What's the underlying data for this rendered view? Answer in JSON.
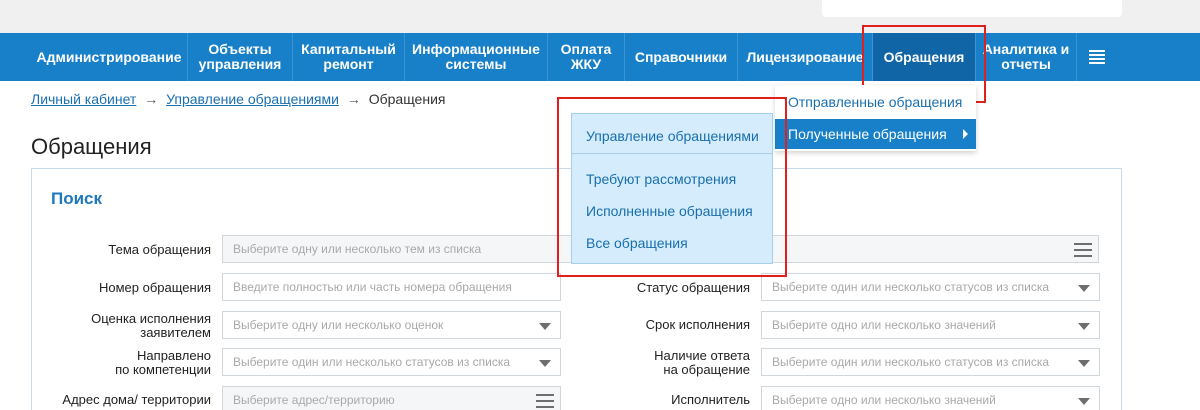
{
  "nav": {
    "items": [
      {
        "label": "Администрирование"
      },
      {
        "label": "Объекты\nуправления"
      },
      {
        "label": "Капитальный\nремонт"
      },
      {
        "label": "Информационные\nсистемы"
      },
      {
        "label": "Оплата\nЖКУ"
      },
      {
        "label": "Справочники"
      },
      {
        "label": "Лицензирование"
      },
      {
        "label": "Обращения",
        "active": true
      },
      {
        "label": "Аналитика и\nотчеты"
      }
    ],
    "menu_icon": "hamburger-menu-icon"
  },
  "dropdown": {
    "items": [
      {
        "label": "Отправленные обращения"
      },
      {
        "label": "Полученные обращения",
        "active": true
      }
    ]
  },
  "submenu": {
    "items": [
      {
        "label": "Управление обращениями"
      },
      {
        "label": "Требуют рассмотрения"
      },
      {
        "label": "Исполненные обращения"
      },
      {
        "label": "Все обращения"
      }
    ]
  },
  "breadcrumb": {
    "link1": "Личный кабинет",
    "link2": "Управление обращениями",
    "separator": "→",
    "current": "Обращения"
  },
  "page": {
    "title": "Обращения"
  },
  "search": {
    "title": "Поиск",
    "fields": {
      "topic": {
        "label": "Тема обращения",
        "placeholder": "Выберите одну или несколько тем из списка"
      },
      "number": {
        "label": "Номер обращения",
        "placeholder": "Введите полностью или часть номера обращения"
      },
      "rating": {
        "label": "Оценка исполнения\nзаявителем",
        "placeholder": "Выберите одну или несколько оценок"
      },
      "directed": {
        "label": "Направлено\nпо компетенции",
        "placeholder": "Выберите один или несколько статусов из списка"
      },
      "address": {
        "label": "Адрес дома/ территории",
        "placeholder": "Выберите адрес/территорию"
      },
      "status": {
        "label": "Статус обращения",
        "placeholder": "Выберите один или несколько статусов из списка"
      },
      "deadline": {
        "label": "Срок исполнения",
        "placeholder": "Выберите одно или несколько значений"
      },
      "answer": {
        "label": "Наличие ответа\nна обращение",
        "placeholder": "Выберите один или несколько статусов из списка"
      },
      "executor": {
        "label": "Исполнитель",
        "placeholder": "Выберите одно или несколько значений"
      }
    }
  },
  "colors": {
    "nav_bg": "#1880c8",
    "nav_active": "#0f65a6",
    "link": "#1a6fb0",
    "highlight_border": "#e0201f",
    "submenu_bg": "#d4ecfb"
  }
}
